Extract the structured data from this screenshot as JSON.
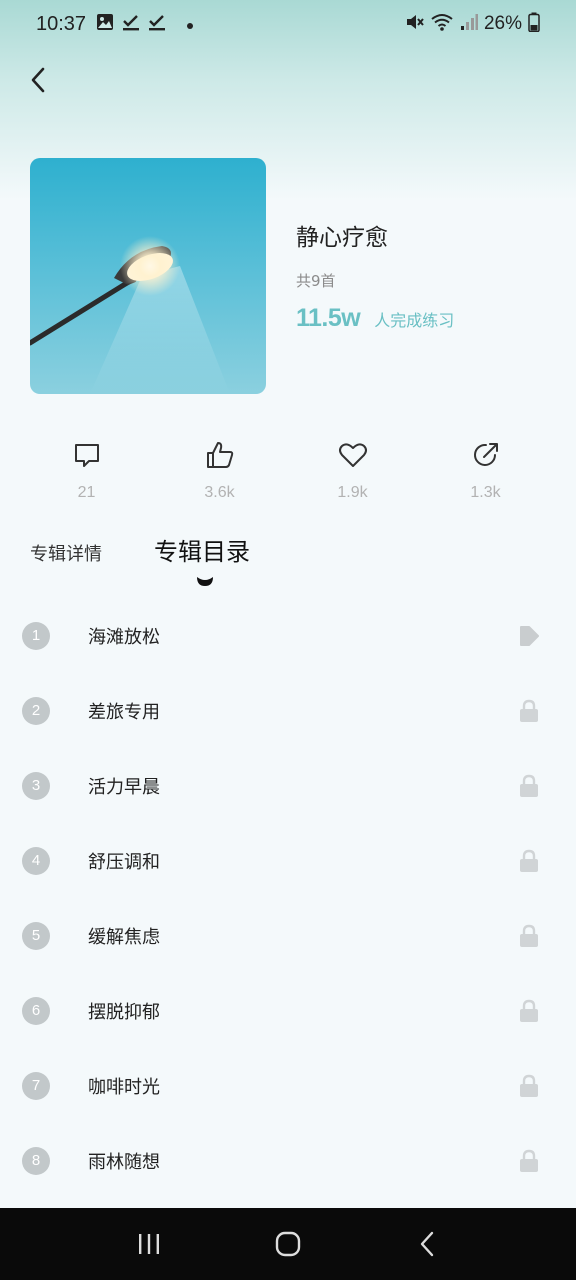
{
  "status_bar": {
    "time": "10:37",
    "battery": "26%",
    "icons_left": [
      "image-icon",
      "check-icon",
      "check-icon",
      "dot-icon"
    ],
    "icons_right": [
      "mute-icon",
      "wifi-icon",
      "signal-icon",
      "battery-icon"
    ]
  },
  "album": {
    "title": "静心疗愈",
    "count": "共9首",
    "completed_num": "11.5w",
    "completed_label": "人完成练习",
    "accent_color": "#6ac0c4"
  },
  "actions": [
    {
      "name": "comment",
      "icon": "comment-icon",
      "count": "21"
    },
    {
      "name": "like",
      "icon": "thumbs-up-icon",
      "count": "3.6k"
    },
    {
      "name": "favorite",
      "icon": "heart-icon",
      "count": "1.9k"
    },
    {
      "name": "share",
      "icon": "share-icon",
      "count": "1.3k"
    }
  ],
  "tabs": {
    "detail": "专辑详情",
    "catalog": "专辑目录",
    "active": "catalog"
  },
  "tracks": [
    {
      "num": "1",
      "name": "海滩放松",
      "state": "play"
    },
    {
      "num": "2",
      "name": "差旅专用",
      "state": "locked"
    },
    {
      "num": "3",
      "name": "活力早晨",
      "state": "locked"
    },
    {
      "num": "4",
      "name": "舒压调和",
      "state": "locked"
    },
    {
      "num": "5",
      "name": "缓解焦虑",
      "state": "locked"
    },
    {
      "num": "6",
      "name": "摆脱抑郁",
      "state": "locked"
    },
    {
      "num": "7",
      "name": "咖啡时光",
      "state": "locked"
    },
    {
      "num": "8",
      "name": "雨林随想",
      "state": "locked"
    }
  ],
  "nav_bar": [
    "recents-icon",
    "home-icon",
    "back-icon"
  ]
}
